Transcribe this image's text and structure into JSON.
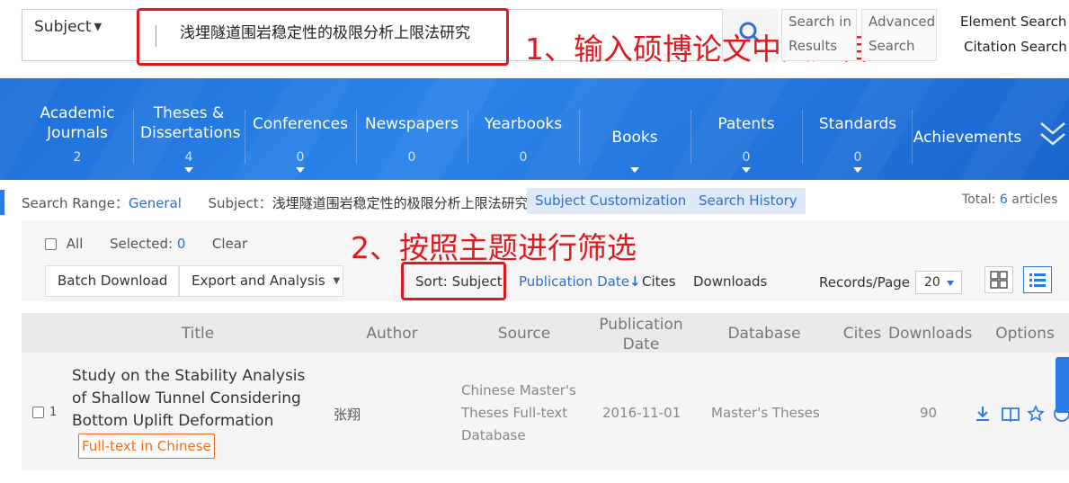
{
  "search": {
    "field_label": "Subject",
    "query": "浅埋隧道围岩稳定性的极限分析上限法研究",
    "search_in_results": "Search in Results",
    "advanced_search": "Advanced Search",
    "element_search": "Element Search",
    "citation_search": "Citation Search"
  },
  "annotations": {
    "step1": "1、输入硕博论文中文题目",
    "step2": "2、按照主题进行筛选",
    "color": "#e0191e"
  },
  "nav": {
    "items": [
      {
        "label": "Academic Journals",
        "count": "2"
      },
      {
        "label": "Theses & Dissertations",
        "count": "4"
      },
      {
        "label": "Conferences",
        "count": "0"
      },
      {
        "label": "Newspapers",
        "count": "0"
      },
      {
        "label": "Yearbooks",
        "count": "0"
      },
      {
        "label": "Books",
        "count": ""
      },
      {
        "label": "Patents",
        "count": "0"
      },
      {
        "label": "Standards",
        "count": "0"
      },
      {
        "label": "Achievements",
        "count": ""
      }
    ],
    "background": "#2b84ea"
  },
  "filter": {
    "range_label": "Search Range：",
    "range_value": "General",
    "subject_label": "Subject：",
    "subject_value": "浅埋隧道围岩稳定性的极限分析上限法研究",
    "subject_customization": "Subject Customization",
    "search_history": "Search History",
    "total_label": "Total:",
    "total_count": "6",
    "total_unit": "articles"
  },
  "toolbar": {
    "all": "All",
    "selected_label": "Selected:",
    "selected_count": "0",
    "clear": "Clear",
    "batch_download": "Batch Download",
    "export_analysis": "Export and Analysis",
    "sort_label": "Sort:",
    "sort_subject": "Subject",
    "sort_pubdate": "Publication Date",
    "sort_cites": "Cites",
    "sort_downloads": "Downloads",
    "records_label": "Records/Page",
    "records_value": "20"
  },
  "table": {
    "headers": {
      "title": "Title",
      "author": "Author",
      "source": "Source",
      "pubdate": "Publication Date",
      "database": "Database",
      "cites": "Cites",
      "downloads": "Downloads",
      "options": "Options"
    },
    "rows": [
      {
        "num": "1",
        "title": "Study on the Stability Analysis of Shallow Tunnel Considering Bottom Uplift Deformation",
        "badge": "Full-text in Chinese",
        "author": "张翔",
        "source": "Chinese Master's Theses Full-text Database",
        "pubdate": "2016-11-01",
        "database": "Master's Theses",
        "cites": "",
        "downloads": "90"
      }
    ]
  },
  "icons": {
    "search": "search-icon",
    "download": "download-icon",
    "read": "book-icon",
    "favorite": "star-icon",
    "cite": "quote-icon",
    "grid_view": "grid-view-icon",
    "list_view": "list-view-icon"
  },
  "colors": {
    "accent": "#2b6fd2",
    "badge": "#f26b20"
  }
}
